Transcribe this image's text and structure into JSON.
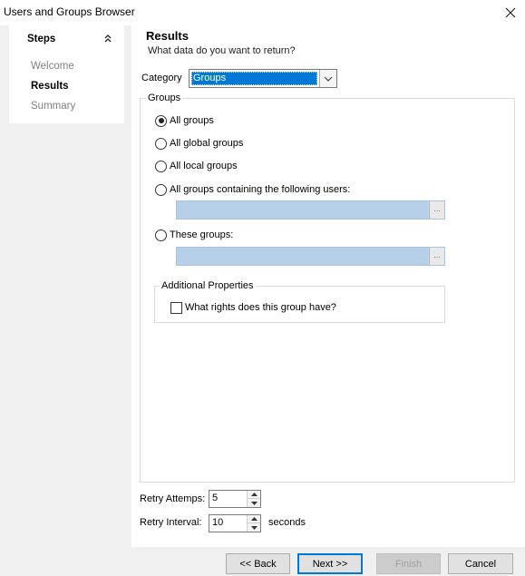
{
  "window": {
    "title": "Users and Groups Browser"
  },
  "steps": {
    "title": "Steps",
    "items": [
      {
        "label": "Welcome",
        "state": "inactive"
      },
      {
        "label": "Results",
        "state": "active"
      },
      {
        "label": "Summary",
        "state": "inactive"
      }
    ]
  },
  "header": {
    "title": "Results",
    "subtitle": "What data do you want to return?"
  },
  "category": {
    "label": "Category",
    "selected": "Groups"
  },
  "groups": {
    "legend": "Groups",
    "options": [
      {
        "label": "All groups",
        "checked": true
      },
      {
        "label": "All global groups",
        "checked": false
      },
      {
        "label": "All local groups",
        "checked": false
      },
      {
        "label": "All groups containing the following users:",
        "checked": false
      },
      {
        "label": "These groups:",
        "checked": false
      }
    ],
    "users_picker": {
      "value": "",
      "button": "..."
    },
    "groups_picker": {
      "value": "",
      "button": "..."
    }
  },
  "additional": {
    "legend": "Additional Properties",
    "checkbox_label": "What rights does this group have?",
    "checked": false
  },
  "retry": {
    "attempts_label": "Retry Attemps:",
    "attempts_value": "5",
    "interval_label": "Retry Interval:",
    "interval_value": "10",
    "interval_unit": "seconds"
  },
  "footer": {
    "back": "<< Back",
    "next": "Next >>",
    "finish": "Finish",
    "cancel": "Cancel"
  },
  "colors": {
    "selection": "#0078d7",
    "picker_fill": "#b7d0ea",
    "panel_bg": "#f0f0f0"
  }
}
